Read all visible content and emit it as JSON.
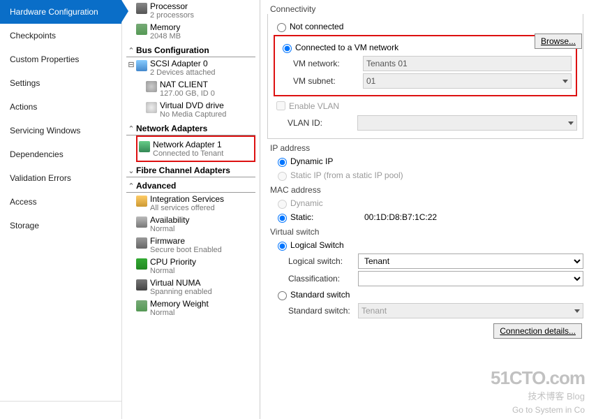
{
  "leftnav": {
    "items": [
      {
        "label": "Hardware Configuration",
        "active": true
      },
      {
        "label": "Checkpoints"
      },
      {
        "label": "Custom Properties"
      },
      {
        "label": "Settings"
      },
      {
        "label": "Actions"
      },
      {
        "label": "Servicing Windows"
      },
      {
        "label": "Dependencies"
      },
      {
        "label": "Validation Errors"
      },
      {
        "label": "Access"
      },
      {
        "label": "Storage"
      }
    ]
  },
  "tree": {
    "processor": {
      "title": "Processor",
      "sub": "2 processors"
    },
    "memory": {
      "title": "Memory",
      "sub": "2048 MB"
    },
    "bus_header": "Bus Configuration",
    "scsi": {
      "title": "SCSI Adapter 0",
      "sub": "2 Devices attached"
    },
    "nat": {
      "title": "NAT CLIENT",
      "sub": "127.00 GB, ID 0"
    },
    "dvd": {
      "title": "Virtual DVD drive",
      "sub": "No Media Captured"
    },
    "net_header": "Network Adapters",
    "na1": {
      "title": "Network Adapter 1",
      "sub": "Connected to Tenant"
    },
    "fc_header": "Fibre Channel Adapters",
    "adv_header": "Advanced",
    "isvc": {
      "title": "Integration Services",
      "sub": "All services offered"
    },
    "avail": {
      "title": "Availability",
      "sub": "Normal"
    },
    "fw": {
      "title": "Firmware",
      "sub": "Secure boot Enabled"
    },
    "cpup": {
      "title": "CPU Priority",
      "sub": "Normal"
    },
    "numa": {
      "title": "Virtual NUMA",
      "sub": "Spanning enabled"
    },
    "memw": {
      "title": "Memory Weight",
      "sub": "Normal"
    }
  },
  "right": {
    "connectivity": {
      "legend": "Connectivity",
      "not_connected": "Not connected",
      "connected": "Connected to a VM network",
      "vm_network_lbl": "VM network:",
      "vm_network_val": "Tenants 01",
      "browse_btn": "Browse...",
      "vm_subnet_lbl": "VM subnet:",
      "vm_subnet_val": "01",
      "enable_vlan": "Enable VLAN",
      "vlan_id_lbl": "VLAN ID:"
    },
    "ip": {
      "legend": "IP address",
      "dynamic": "Dynamic IP",
      "static": "Static IP (from a static IP pool)"
    },
    "mac": {
      "legend": "MAC address",
      "dynamic": "Dynamic",
      "static": "Static:",
      "value": "00:1D:D8:B7:1C:22"
    },
    "vswitch": {
      "legend": "Virtual switch",
      "logical": "Logical Switch",
      "logical_switch_lbl": "Logical switch:",
      "logical_switch_val": "Tenant",
      "classification_lbl": "Classification:",
      "classification_val": "",
      "standard": "Standard switch",
      "standard_switch_lbl": "Standard switch:",
      "standard_switch_val": "Tenant"
    },
    "conn_details_btn": "Connection details...",
    "watermark1": "51CTO.com",
    "watermark2": "技术博客      Blog",
    "sys_hint": "Go to System in Co"
  }
}
